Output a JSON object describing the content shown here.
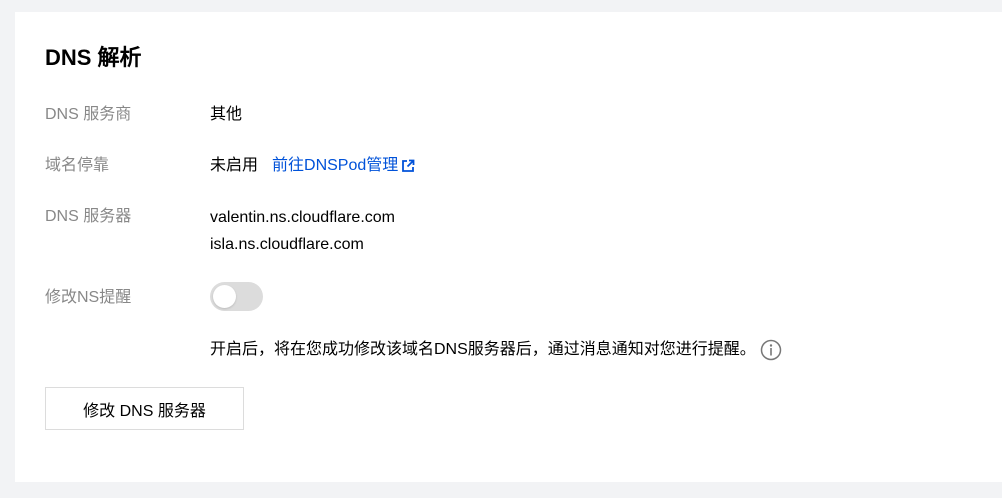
{
  "section": {
    "title": "DNS 解析"
  },
  "rows": {
    "provider": {
      "label": "DNS 服务商",
      "value": "其他"
    },
    "parking": {
      "label": "域名停靠",
      "value": "未启用",
      "link": "前往DNSPod管理"
    },
    "servers": {
      "label": "DNS 服务器",
      "values": [
        "valentin.ns.cloudflare.com",
        "isla.ns.cloudflare.com"
      ]
    },
    "reminder": {
      "label": "修改NS提醒",
      "enabled": false,
      "hint": "开启后，将在您成功修改该域名DNS服务器后，通过消息通知对您进行提醒。"
    }
  },
  "actions": {
    "modify_label": "修改 DNS 服务器"
  },
  "icons": {
    "external": "external-link-icon",
    "info": "info-icon"
  },
  "colors": {
    "link": "#0052d9",
    "label": "#888888",
    "toggle_off": "#dcdcdc"
  }
}
